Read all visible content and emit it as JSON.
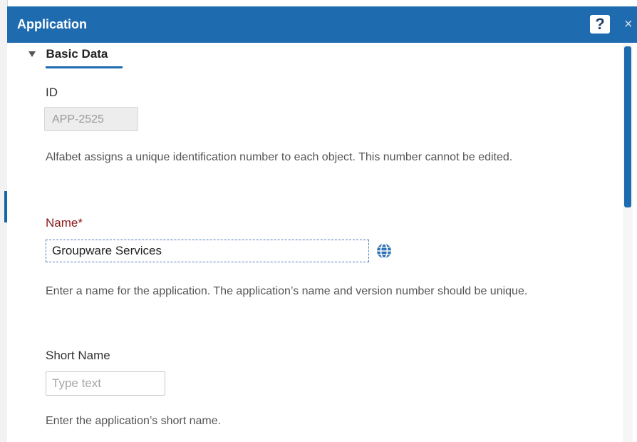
{
  "window": {
    "title": "Application",
    "help_label": "?",
    "close_label": "×"
  },
  "section": {
    "title": "Basic Data",
    "expanded": true
  },
  "fields": {
    "id": {
      "label": "ID",
      "value": "APP-2525",
      "help": "Alfabet assigns a unique identification number to each object. This number cannot be edited."
    },
    "name": {
      "label": "Name*",
      "value": "Groupware Services",
      "help": "Enter a name for the application. The application’s name and version number should be unique.",
      "icon": "globe-icon"
    },
    "short_name": {
      "label": "Short Name",
      "value": "",
      "placeholder": "Type text",
      "help": "Enter the application’s short name."
    }
  },
  "colors": {
    "header": "#1f6bb0",
    "required_label": "#8b1a1a",
    "scrollbar": "#1f6bb0"
  }
}
